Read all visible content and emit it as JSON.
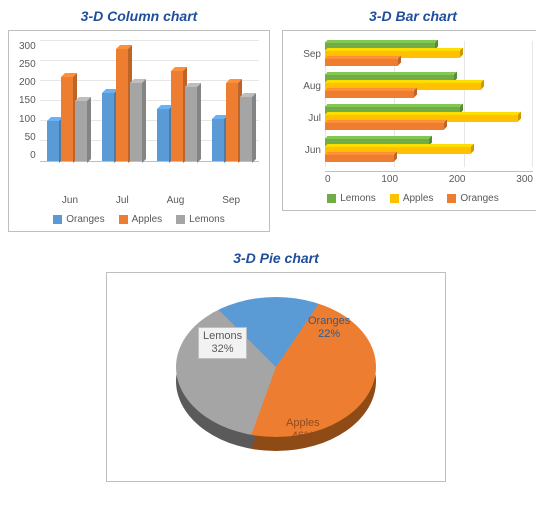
{
  "titles": {
    "column": "3-D Column chart",
    "bar": "3-D Bar chart",
    "pie": "3-D Pie chart"
  },
  "legend_column": {
    "s1": "Oranges",
    "s2": "Apples",
    "s3": "Lemons"
  },
  "legend_bar": {
    "s1": "Lemons",
    "s2": "Apples",
    "s3": "Oranges"
  },
  "column": {
    "yticks": {
      "t0": "0",
      "t1": "50",
      "t2": "100",
      "t3": "150",
      "t4": "200",
      "t5": "250",
      "t6": "300"
    },
    "xlabels": {
      "c0": "Jun",
      "c1": "Jul",
      "c2": "Aug",
      "c3": "Sep"
    }
  },
  "bar": {
    "ylabels": {
      "r0": "Sep",
      "r1": "Aug",
      "r2": "Jul",
      "r3": "Jun"
    },
    "xticks": {
      "t0": "0",
      "t1": "100",
      "t2": "200",
      "t3": "300"
    }
  },
  "pie_labels": {
    "lemons_name": "Lemons",
    "lemons_pct": "32%",
    "oranges_name": "Oranges",
    "oranges_pct": "22%",
    "apples_name": "Apples",
    "apples_pct": "46%"
  },
  "colors": {
    "oranges": "#5b9bd5",
    "apples": "#ed7d31",
    "lemons_col": "#a5a5a5",
    "lemons_bar": "#70ad47",
    "apples_bar": "#ffc000",
    "oranges_bar": "#ed7d31"
  },
  "chart_data": [
    {
      "type": "bar",
      "title": "3-D Column chart",
      "orientation": "vertical",
      "categories": [
        "Jun",
        "Jul",
        "Aug",
        "Sep"
      ],
      "series": [
        {
          "name": "Oranges",
          "values": [
            100,
            170,
            130,
            105
          ]
        },
        {
          "name": "Apples",
          "values": [
            210,
            280,
            225,
            195
          ]
        },
        {
          "name": "Lemons",
          "values": [
            150,
            195,
            185,
            160
          ]
        }
      ],
      "ylim": [
        0,
        300
      ],
      "ytick_step": 50
    },
    {
      "type": "bar",
      "title": "3-D Bar chart",
      "orientation": "horizontal",
      "categories": [
        "Jun",
        "Jul",
        "Aug",
        "Sep"
      ],
      "series": [
        {
          "name": "Lemons",
          "values": [
            150,
            195,
            185,
            160
          ]
        },
        {
          "name": "Apples",
          "values": [
            210,
            280,
            225,
            195
          ]
        },
        {
          "name": "Oranges",
          "values": [
            100,
            170,
            130,
            105
          ]
        }
      ],
      "xlim": [
        0,
        300
      ],
      "xtick_step": 100,
      "y_display_order": [
        "Sep",
        "Aug",
        "Jul",
        "Jun"
      ]
    },
    {
      "type": "pie",
      "title": "3-D Pie chart",
      "slices": [
        {
          "name": "Oranges",
          "percent": 22
        },
        {
          "name": "Apples",
          "percent": 46
        },
        {
          "name": "Lemons",
          "percent": 32
        }
      ]
    }
  ]
}
